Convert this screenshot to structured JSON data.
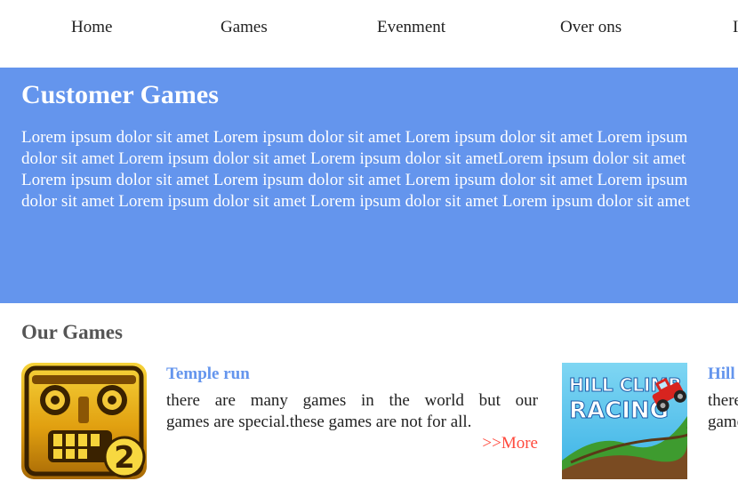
{
  "nav": {
    "items": [
      {
        "label": "Home"
      },
      {
        "label": "Games"
      },
      {
        "label": "Evenment"
      },
      {
        "label": "Over ons"
      },
      {
        "label": "I"
      }
    ]
  },
  "hero": {
    "title": "Customer Games",
    "lines": [
      "Lorem ipsum dolor sit amet Lorem ipsum dolor sit amet Lorem ipsum dolor sit amet Lorem ipsum",
      "dolor sit amet Lorem ipsum dolor sit amet Lorem ipsum dolor sit ametLorem ipsum dolor sit amet",
      "Lorem ipsum dolor sit amet Lorem ipsum dolor sit amet Lorem ipsum dolor sit amet Lorem ipsum",
      "dolor sit amet Lorem ipsum dolor sit amet Lorem ipsum dolor sit amet Lorem ipsum dolor sit amet"
    ]
  },
  "section": {
    "title": "Our Games"
  },
  "games": [
    {
      "title": "Temple run",
      "desc_lines": [
        "there are many games in the world but our",
        "games are special.these games are not for all."
      ],
      "more": ">>More",
      "icon": "temple-run-2-icon"
    },
    {
      "title": "Hill climb racing",
      "desc_lines": [
        "there are many games",
        "games are special"
      ],
      "thumb_text": [
        "HILL CLIMB",
        "RACING"
      ],
      "icon": "hill-climb-racing-icon"
    }
  ],
  "colors": {
    "hero_bg": "#6495ed",
    "link": "#6495ed",
    "more": "#ff4a3d"
  }
}
